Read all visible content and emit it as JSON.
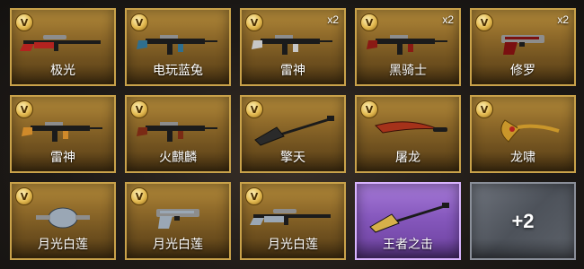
{
  "badge_letter": "V",
  "items": [
    {
      "name": "极光",
      "qty": "",
      "kind": "sniper-rifle",
      "accent": "#b3231f"
    },
    {
      "name": "电玩蓝兔",
      "qty": "",
      "kind": "assault-rifle",
      "accent": "#2f6f8f"
    },
    {
      "name": "雷神",
      "qty": "x2",
      "kind": "assault-rifle",
      "accent": "#c7c7c7"
    },
    {
      "name": "黑骑士",
      "qty": "x2",
      "kind": "assault-rifle",
      "accent": "#8a1a14"
    },
    {
      "name": "修罗",
      "qty": "x2",
      "kind": "pistol",
      "accent": "#7a1010"
    },
    {
      "name": "雷神",
      "qty": "",
      "kind": "assault-rifle",
      "accent": "#d08a2a"
    },
    {
      "name": "火麒麟",
      "qty": "",
      "kind": "assault-rifle",
      "accent": "#7a2a14"
    },
    {
      "name": "擎天",
      "qty": "",
      "kind": "shovel",
      "accent": "#2a2a2a"
    },
    {
      "name": "屠龙",
      "qty": "",
      "kind": "blade",
      "accent": "#a5321a"
    },
    {
      "name": "龙啸",
      "qty": "",
      "kind": "claw",
      "accent": "#c9962a"
    },
    {
      "name": "月光白莲",
      "qty": "",
      "kind": "grenade",
      "accent": "#9aa7b5"
    },
    {
      "name": "月光白莲",
      "qty": "",
      "kind": "pistol",
      "accent": "#9aa7b5"
    },
    {
      "name": "月光白莲",
      "qty": "",
      "kind": "sniper-rifle",
      "accent": "#9aa7b5"
    },
    {
      "name": "王者之击",
      "qty": "",
      "kind": "shovel",
      "accent": "#d6b04a",
      "rarity": "purple"
    }
  ],
  "more": {
    "label": "+2"
  }
}
